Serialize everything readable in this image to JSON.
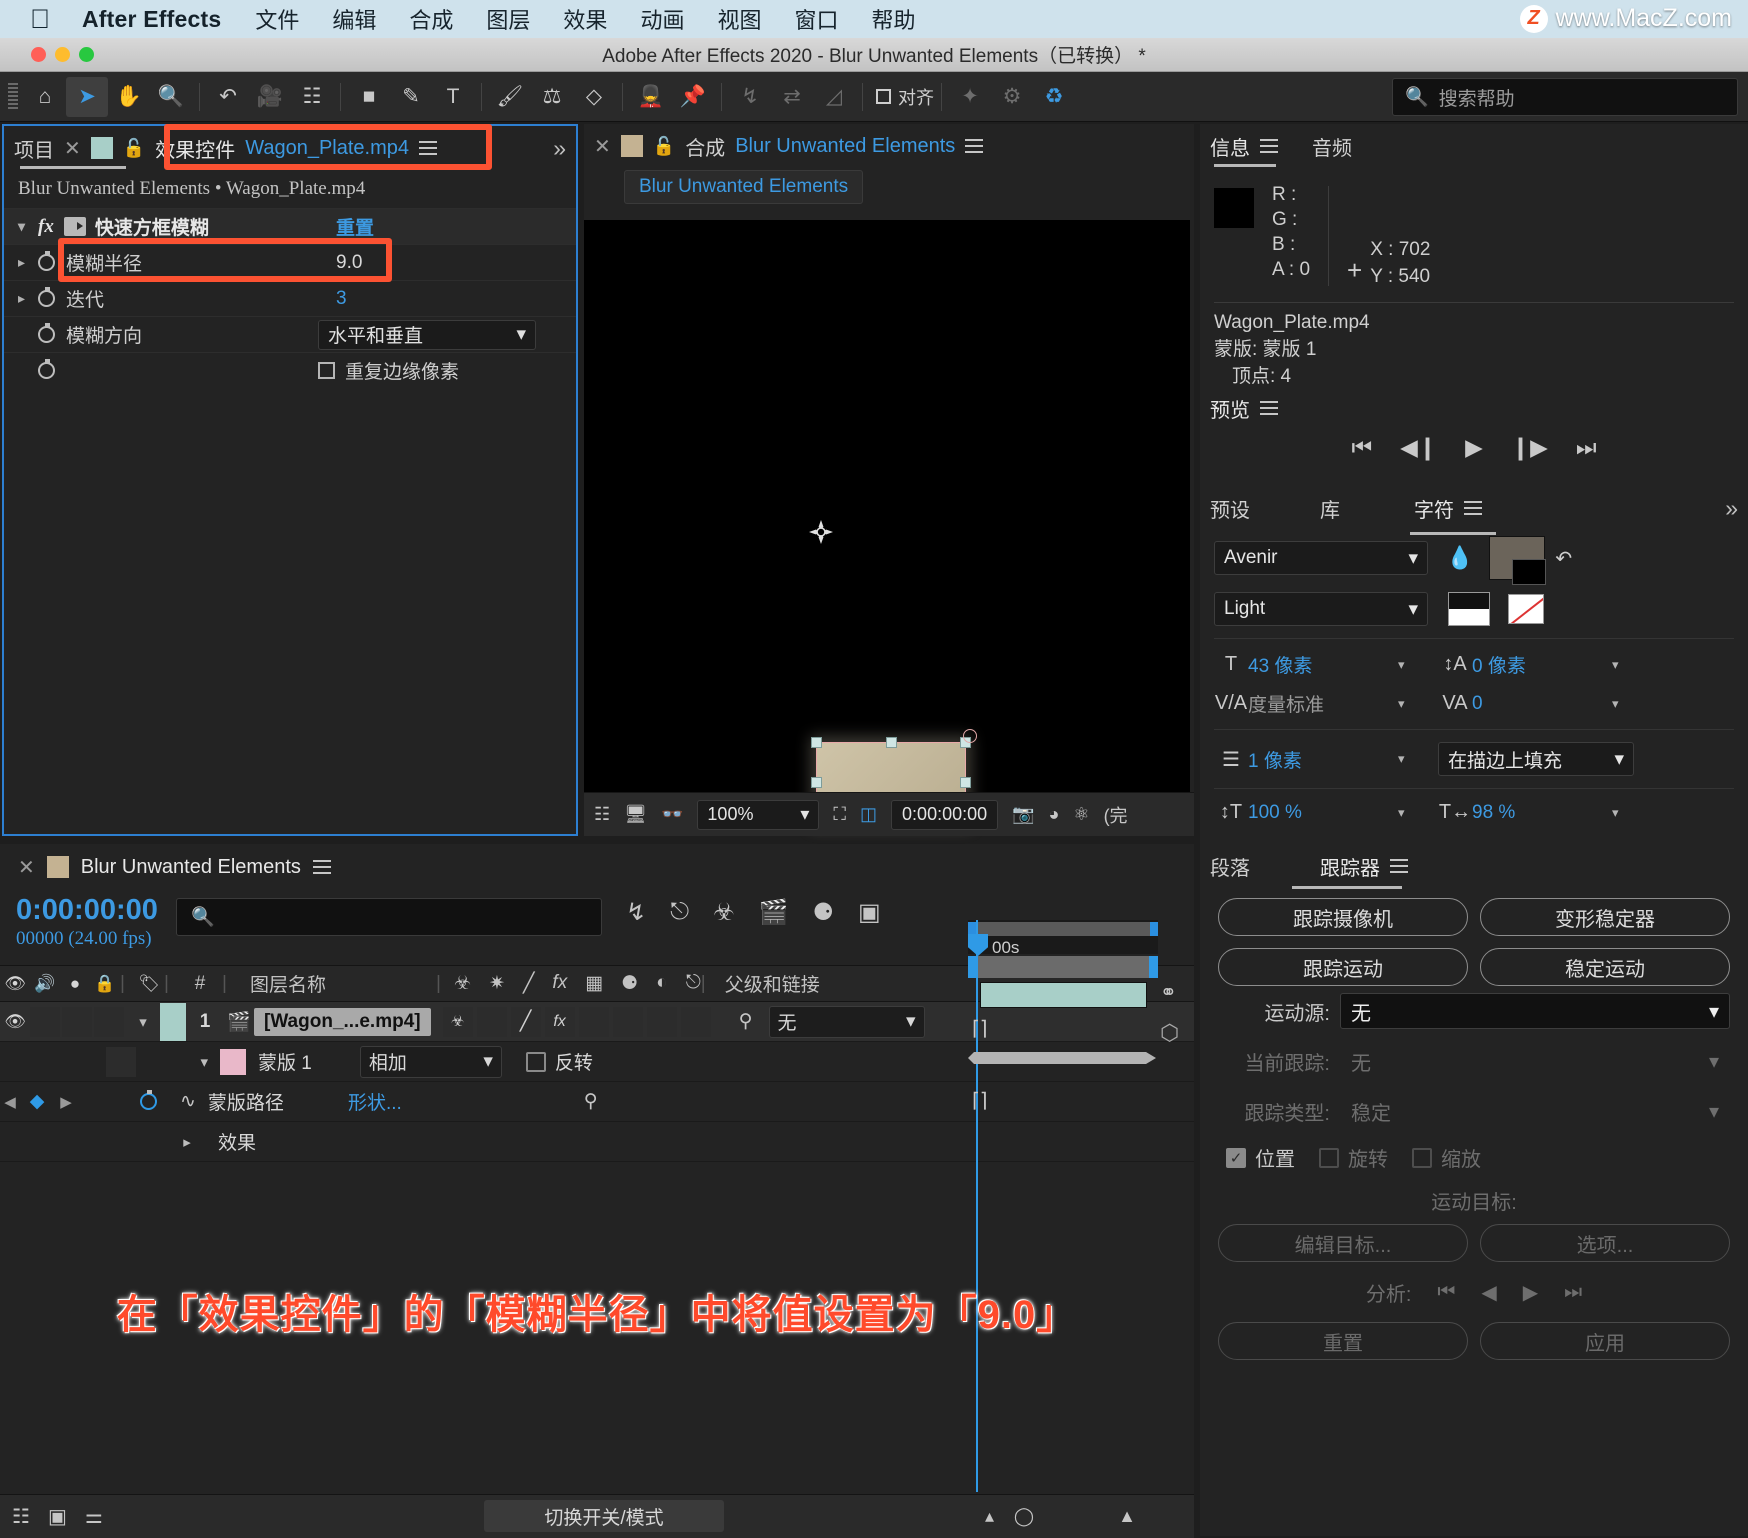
{
  "macbar": {
    "app_name": "After Effects",
    "menus": [
      "文件",
      "编辑",
      "合成",
      "图层",
      "效果",
      "动画",
      "视图",
      "窗口",
      "帮助"
    ],
    "watermark": {
      "badge": "Z",
      "text": "www.MacZ.com"
    }
  },
  "window": {
    "title": "Adobe After Effects 2020 - Blur Unwanted Elements（已转换）  *"
  },
  "toolbar": {
    "align_label": "对齐",
    "search_placeholder": "搜索帮助"
  },
  "effect_controls": {
    "project_tab": "项目",
    "tab_title": "效果控件",
    "tab_file": "Wagon_Plate.mp4",
    "subtitle": "Blur Unwanted Elements • Wagon_Plate.mp4",
    "effect_name": "快速方框模糊",
    "reset_label": "重置",
    "rows": [
      {
        "label": "模糊半径",
        "value": "9.0",
        "type": "number"
      },
      {
        "label": "迭代",
        "value": "3",
        "type": "number-blue"
      },
      {
        "label": "模糊方向",
        "value": "水平和垂直",
        "type": "select"
      },
      {
        "label": "重复边缘像素",
        "value": "",
        "type": "checkbox"
      }
    ]
  },
  "composition": {
    "tab_label": "合成",
    "comp_name": "Blur Unwanted Elements",
    "breadcrumb": "Blur Unwanted Elements",
    "zoom": "100%",
    "timecode": "0:00:00:00",
    "resolution": "(完"
  },
  "info": {
    "tab_info": "信息",
    "tab_audio": "音频",
    "channels": [
      "R :",
      "G :",
      "B :",
      "A :  0"
    ],
    "x_label": "X : 702",
    "y_label": "Y : 540",
    "file_name": "Wagon_Plate.mp4",
    "mask_line": "蒙版: 蒙版 1",
    "vertex_line": "顶点: 4"
  },
  "preview": {
    "title": "预览"
  },
  "character": {
    "tab_presets": "预设",
    "tab_library": "库",
    "tab_character": "字符",
    "font_family": "Avenir",
    "font_style": "Light",
    "font_size": "43 像素",
    "leading": "0 像素",
    "kerning": "度量标准",
    "tracking": "0",
    "stroke_width": "1 像素",
    "stroke_fill_order": "在描边上填充",
    "vertical_scale": "100 %",
    "horizontal_scale": "98 %"
  },
  "tracker": {
    "tab_paragraph": "段落",
    "tab_tracker": "跟踪器",
    "buttons": [
      "跟踪摄像机",
      "变形稳定器",
      "跟踪运动",
      "稳定运动"
    ],
    "motion_source_label": "运动源:",
    "motion_source_value": "无",
    "current_track_label": "当前跟踪:",
    "current_track_value": "无",
    "track_type_label": "跟踪类型:",
    "track_type_value": "稳定",
    "checks": [
      {
        "label": "位置",
        "checked": true
      },
      {
        "label": "旋转",
        "checked": false
      },
      {
        "label": "缩放",
        "checked": false
      }
    ],
    "motion_target_label": "运动目标:",
    "edit_target_button": "编辑目标...",
    "options_button": "选项...",
    "analyze_label": "分析:",
    "reset_button": "重置",
    "apply_button": "应用"
  },
  "timeline": {
    "tab_name": "Blur Unwanted Elements",
    "timecode": "0:00:00:00",
    "frame_info": "00000 (24.00 fps)",
    "ruler_label": "00s",
    "columns": [
      "#",
      "图层名称",
      "父级和链接"
    ],
    "layer": {
      "index": "1",
      "name": "[Wagon_...e.mp4]",
      "parent": "无"
    },
    "mask": {
      "name": "蒙版 1",
      "mode": "相加",
      "invert_label": "反转",
      "path_label": "蒙版路径",
      "path_value": "形状..."
    },
    "effects_group": "效果",
    "switch_modes_button": "切换开关/模式"
  },
  "caption": {
    "text": "在「效果控件」的「模糊半径」中将值设置为「9.0」"
  }
}
